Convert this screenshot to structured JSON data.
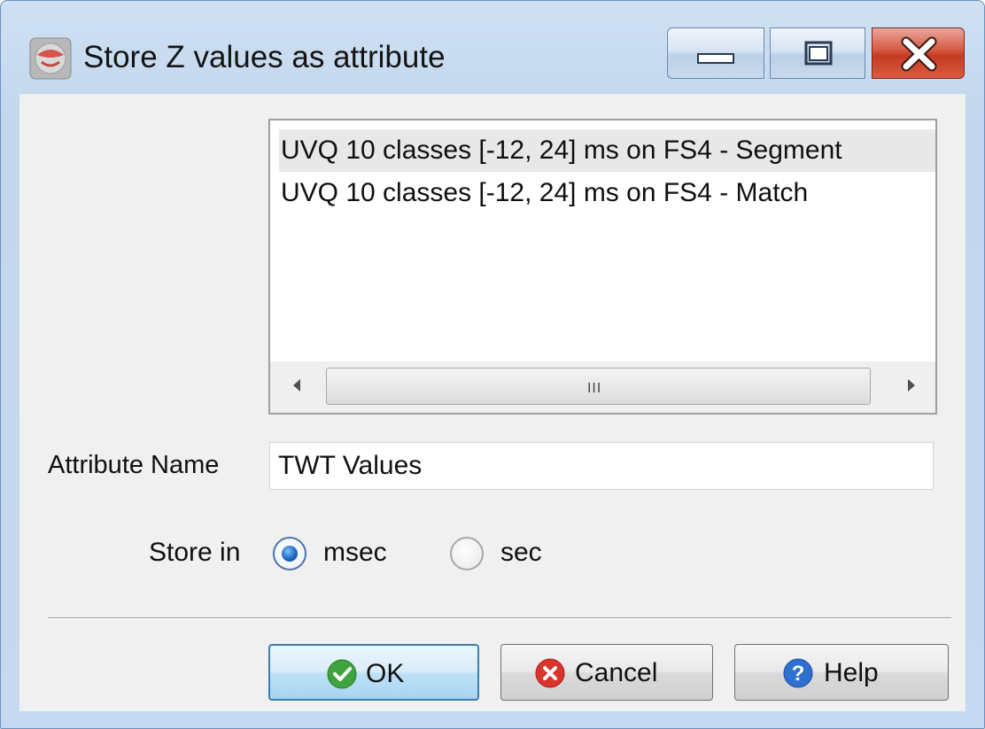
{
  "window": {
    "title": "Store Z values as attribute",
    "app_icon": "sphere-app-icon",
    "controls": [
      "minimize-icon",
      "maximize-icon",
      "close-icon"
    ]
  },
  "list": {
    "items": [
      {
        "label": "UVQ 10 classes [-12, 24] ms on FS4 - Segment",
        "selected": true
      },
      {
        "label": "UVQ 10 classes [-12, 24] ms on FS4 - Match",
        "selected": false
      }
    ],
    "scrollbar_grip": "III"
  },
  "attribute": {
    "label": "Attribute Name",
    "value": "TWT Values"
  },
  "store": {
    "label": "Store in",
    "options": [
      {
        "label": "msec",
        "selected": true
      },
      {
        "label": "sec",
        "selected": false
      }
    ]
  },
  "buttons": {
    "ok": "OK",
    "cancel": "Cancel",
    "help": "Help"
  },
  "colors": {
    "ok_icon": "#3fa33f",
    "cancel_icon": "#d9342b",
    "help_icon": "#2f6fd0",
    "close_button": "#c9452c"
  }
}
